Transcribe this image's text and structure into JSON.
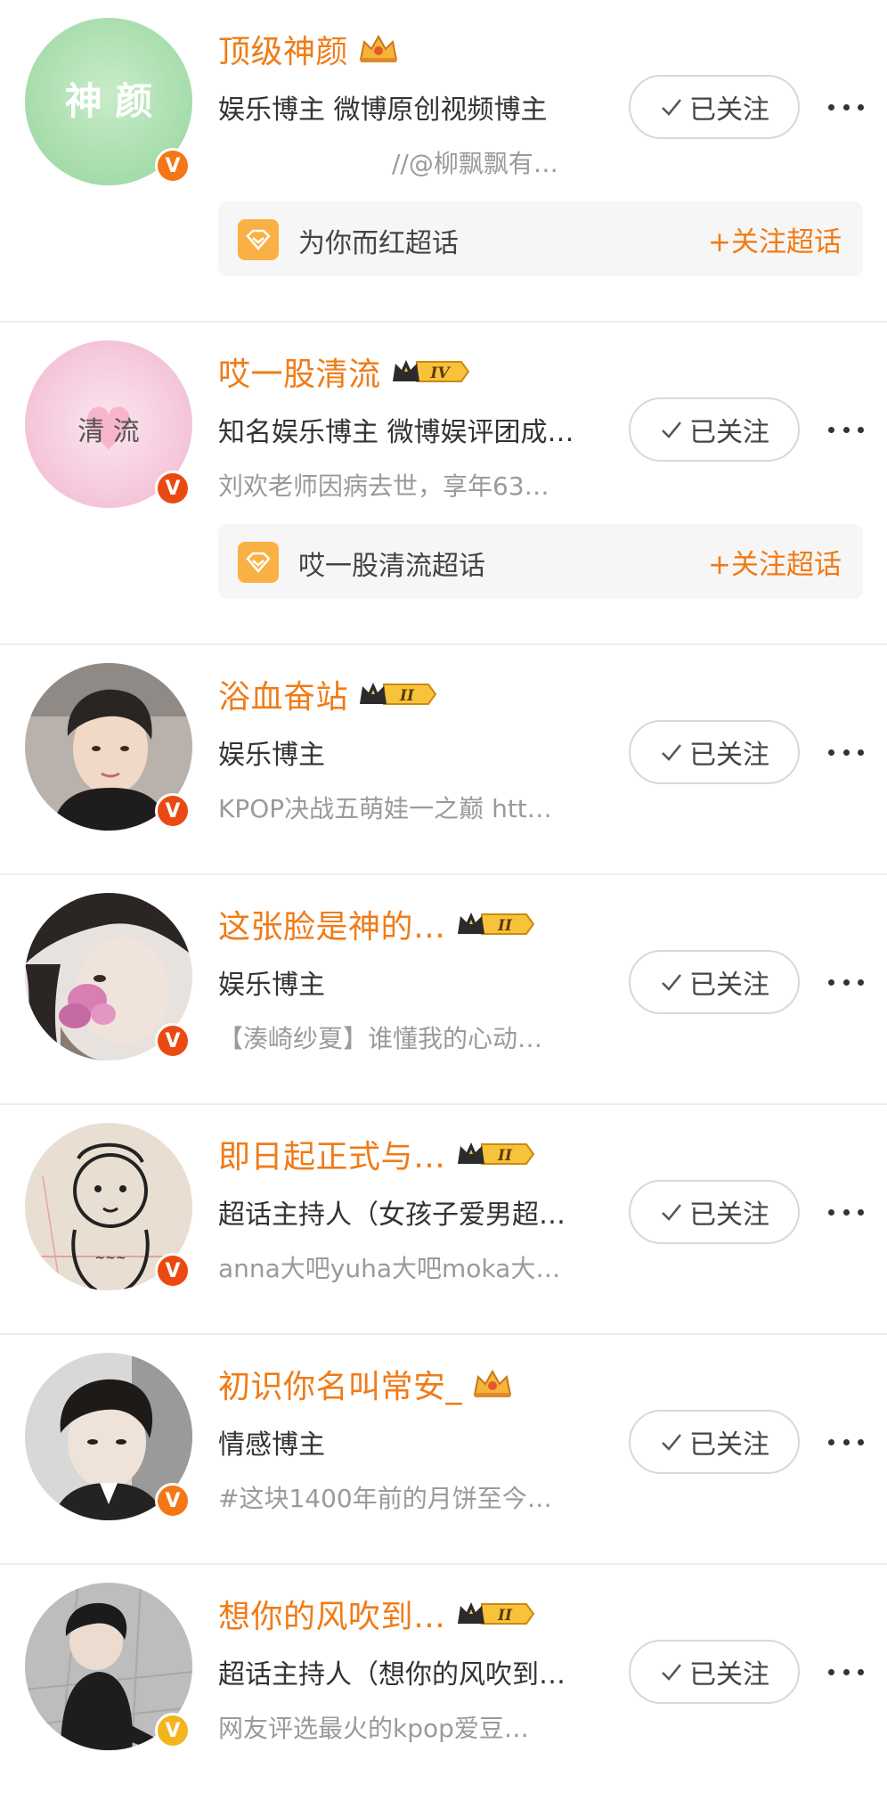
{
  "follow_label": "已关注",
  "items": [
    {
      "name": "顶级神颜",
      "badge": "crown-gold",
      "verified": "orange",
      "desc": "娱乐博主 微博原创视频博主",
      "sub": "//@柳飘飘有…",
      "avatar_text": "神 颜",
      "topic": {
        "name": "为你而红超话",
        "follow": "+关注超话"
      }
    },
    {
      "name": "哎一股清流",
      "badge": "crown-level",
      "level": "IV",
      "verified": "red",
      "desc": "知名娱乐博主 微博娱评团成…",
      "sub": "刘欢老师因病去世，享年63…",
      "avatar_text": "清 流",
      "topic": {
        "name": "哎一股清流超话",
        "follow": "+关注超话"
      }
    },
    {
      "name": "浴血奋站",
      "badge": "crown-level",
      "level": "II",
      "verified": "red",
      "desc": "娱乐博主",
      "sub": "KPOP决战五萌娃一之巅 htt…"
    },
    {
      "name": "这张脸是神的…",
      "badge": "crown-level",
      "level": "II",
      "verified": "red",
      "desc": "娱乐博主",
      "sub": "【湊崎纱夏】谁懂我的心动…"
    },
    {
      "name": "即日起正式与…",
      "badge": "crown-level",
      "level": "II",
      "verified": "red",
      "desc": "超话主持人（女孩子爱男超…",
      "sub": "anna大吧yuha大吧moka大…"
    },
    {
      "name": "初识你名叫常安_",
      "badge": "crown-gold",
      "verified": "orange",
      "desc": "情感博主",
      "sub": "#这块1400年前的月饼至今…"
    },
    {
      "name": "想你的风吹到…",
      "badge": "crown-level",
      "level": "II",
      "verified": "yellow",
      "desc": "超话主持人（想你的风吹到…",
      "sub": "网友评选最火的kpop爱豆…"
    }
  ]
}
